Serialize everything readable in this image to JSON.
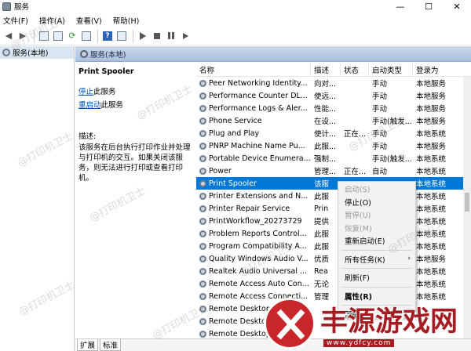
{
  "window": {
    "title": "服务",
    "minimize": "—",
    "maximize": "☐",
    "close": "✕"
  },
  "menu": [
    "文件(F)",
    "操作(A)",
    "查看(V)",
    "帮助(H)"
  ],
  "tree": {
    "root_label": "服务(本地)"
  },
  "content_header": "服务(本地)",
  "detail": {
    "service_name": "Print Spooler",
    "stop_link": "停止",
    "stop_suffix": "此服务",
    "restart_link": "重启动",
    "restart_suffix": "此服务",
    "desc_label": "描述:",
    "description": "该服务在后台执行打印作业并处理与打印机的交互。如果关闭该服务，则无法进行打印或查看打印机。"
  },
  "columns": [
    "名称",
    "描述",
    "状态",
    "启动类型",
    "登录为"
  ],
  "rows": [
    {
      "name": "Peer Networking Identity...",
      "desc": "向对...",
      "status": "",
      "start": "手动",
      "logon": "本地服务"
    },
    {
      "name": "Performance Counter DL...",
      "desc": "使远...",
      "status": "",
      "start": "手动",
      "logon": "本地服务"
    },
    {
      "name": "Performance Logs & Aler...",
      "desc": "性能...",
      "status": "",
      "start": "手动",
      "logon": "本地服务"
    },
    {
      "name": "Phone Service",
      "desc": "在设...",
      "status": "",
      "start": "手动(触发...",
      "logon": "本地服务"
    },
    {
      "name": "Plug and Play",
      "desc": "使计...",
      "status": "正在...",
      "start": "手动",
      "logon": "本地系统"
    },
    {
      "name": "PNRP Machine Name Pu...",
      "desc": "此服...",
      "status": "",
      "start": "手动",
      "logon": "本地服务"
    },
    {
      "name": "Portable Device Enumera...",
      "desc": "强制...",
      "status": "",
      "start": "手动(触发...",
      "logon": "本地系统"
    },
    {
      "name": "Power",
      "desc": "管理...",
      "status": "正在...",
      "start": "自动",
      "logon": "本地系统"
    },
    {
      "name": "Print Spooler",
      "desc": "该服",
      "status": "",
      "start": "",
      "logon": "本地系统"
    },
    {
      "name": "Printer Extensions and N...",
      "desc": "此服",
      "status": "",
      "start": "",
      "logon": "本地系统"
    },
    {
      "name": "Printer Repair Service",
      "desc": "Prin",
      "status": "",
      "start": "",
      "logon": "本地系统"
    },
    {
      "name": "PrintWorkflow_20273729",
      "desc": "提供",
      "status": "",
      "start": "",
      "logon": "本地系统"
    },
    {
      "name": "Problem Reports Control...",
      "desc": "此服",
      "status": "",
      "start": "",
      "logon": "本地系统"
    },
    {
      "name": "Program Compatibility A...",
      "desc": "此服",
      "status": "",
      "start": "",
      "logon": "本地系统"
    },
    {
      "name": "Quality Windows Audio V...",
      "desc": "优质",
      "status": "",
      "start": "",
      "logon": "本地服务"
    },
    {
      "name": "Realtek Audio Universal ...",
      "desc": "Rea",
      "status": "",
      "start": "",
      "logon": "本地系统"
    },
    {
      "name": "Remote Access Auto Con...",
      "desc": "无论",
      "status": "",
      "start": "",
      "logon": "本地系统"
    },
    {
      "name": "Remote Access Connecti...",
      "desc": "管理",
      "status": "",
      "start": "",
      "logon": "本地系统"
    },
    {
      "name": "Remote Desktop ...",
      "desc": "",
      "status": "",
      "start": "",
      "logon": ""
    },
    {
      "name": "Remote Desktop ...",
      "desc": "",
      "status": "",
      "start": "",
      "logon": ""
    },
    {
      "name": "Remote Desktop ...",
      "desc": "",
      "status": "",
      "start": "",
      "logon": ""
    }
  ],
  "selected_row": 8,
  "context_menu": [
    {
      "label": "启动(S)",
      "disabled": true
    },
    {
      "label": "停止(O)",
      "disabled": false
    },
    {
      "label": "暂停(U)",
      "disabled": true
    },
    {
      "label": "恢复(M)",
      "disabled": true
    },
    {
      "label": "重新启动(E)",
      "disabled": false
    },
    {
      "sep": true
    },
    {
      "label": "所有任务(K)",
      "disabled": false,
      "submenu": true
    },
    {
      "sep": true
    },
    {
      "label": "刷新(F)",
      "disabled": false
    },
    {
      "sep": true
    },
    {
      "label": "属性(R)",
      "disabled": false,
      "bold": true
    },
    {
      "sep": true
    },
    {
      "label": "帮助(H)",
      "disabled": false
    }
  ],
  "tabs": [
    "扩展",
    "标准"
  ],
  "watermark": "@打印机卫士",
  "logo": {
    "text": "丰源游戏网",
    "url": "www.ydfcy.com"
  },
  "colors": {
    "selection": "#0078d7",
    "link": "#0054b9",
    "header": "#b9cde6",
    "logo_red": "#c8262b"
  }
}
